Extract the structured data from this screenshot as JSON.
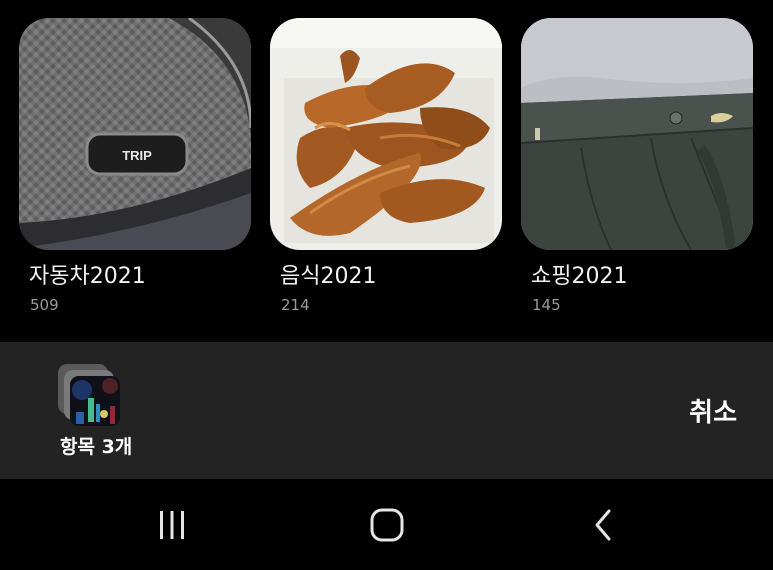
{
  "albums": [
    {
      "name": "자동차2021",
      "count": "509",
      "thumbnail_icon": "car-trip-button-photo",
      "thumbnail_text": "TRIP"
    },
    {
      "name": "음식2021",
      "count": "214",
      "thumbnail_icon": "potato-wedges-photo"
    },
    {
      "name": "쇼핑2021",
      "count": "145",
      "thumbnail_icon": "gray-trousers-photo"
    }
  ],
  "selection": {
    "count_label": "항목 3개",
    "cancel_label": "취소",
    "stack_icon": "selected-items-stack"
  },
  "nav": {
    "recents_icon": "recents-icon",
    "home_icon": "home-icon",
    "back_icon": "back-icon"
  },
  "colors": {
    "background": "#000000",
    "selection_bar": "#232323",
    "count_text": "#9a9a9a",
    "primary_text": "#ffffff"
  }
}
